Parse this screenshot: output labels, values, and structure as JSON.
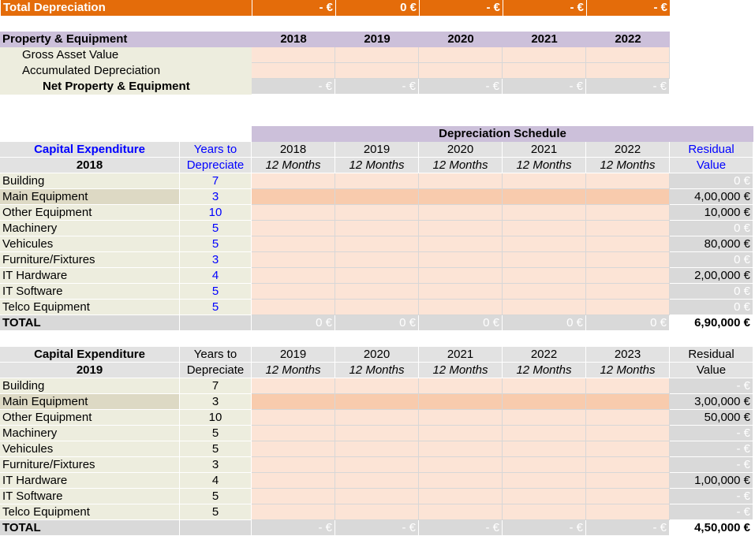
{
  "total_depreciation": {
    "label": "Total Depreciation",
    "values": [
      "- €",
      "0 €",
      "- €",
      "- €",
      "- €"
    ]
  },
  "property_equipment": {
    "title": "Property & Equipment",
    "years": [
      "2018",
      "2019",
      "2020",
      "2021",
      "2022"
    ],
    "rows": [
      {
        "label": "Gross Asset Value"
      },
      {
        "label": "Accumulated Depreciation"
      }
    ],
    "net_label": "Net Property & Equipment",
    "net_values": [
      "- €",
      "- €",
      "- €",
      "- €",
      "- €"
    ]
  },
  "schedule_title": "Depreciation Schedule",
  "block_2018": {
    "title_line1": "Capital Expenditure",
    "title_line2": "2018",
    "years_to_line1": "Years to",
    "years_to_line2": "Depreciate",
    "years": [
      "2018",
      "2019",
      "2020",
      "2021",
      "2022"
    ],
    "period": "12 Months",
    "residual_line1": "Residual",
    "residual_line2": "Value",
    "rows": [
      {
        "label": "Building",
        "years": "7",
        "residual": "0 €"
      },
      {
        "label": "Main Equipment",
        "years": "3",
        "residual": "4,00,000 €"
      },
      {
        "label": "Other Equipment",
        "years": "10",
        "residual": "10,000 €"
      },
      {
        "label": "Machinery",
        "years": "5",
        "residual": "0 €"
      },
      {
        "label": "Vehicules",
        "years": "5",
        "residual": "80,000 €"
      },
      {
        "label": "Furniture/Fixtures",
        "years": "3",
        "residual": "0 €"
      },
      {
        "label": "IT Hardware",
        "years": "4",
        "residual": "2,00,000 €"
      },
      {
        "label": "IT Software",
        "years": "5",
        "residual": "0 €"
      },
      {
        "label": "Telco Equipment",
        "years": "5",
        "residual": "0 €"
      }
    ],
    "total_label": "TOTAL",
    "total_values": [
      "0 €",
      "0 €",
      "0 €",
      "0 €",
      "0 €"
    ],
    "total_residual": "6,90,000 €"
  },
  "block_2019": {
    "title_line1": "Capital Expenditure",
    "title_line2": "2019",
    "years_to_line1": "Years to",
    "years_to_line2": "Depreciate",
    "years": [
      "2019",
      "2020",
      "2021",
      "2022",
      "2023"
    ],
    "period": "12 Months",
    "residual_line1": "Residual",
    "residual_line2": "Value",
    "rows": [
      {
        "label": "Building",
        "years": "7",
        "residual": "- €"
      },
      {
        "label": "Main Equipment",
        "years": "3",
        "residual": "3,00,000 €"
      },
      {
        "label": "Other Equipment",
        "years": "10",
        "residual": "50,000 €"
      },
      {
        "label": "Machinery",
        "years": "5",
        "residual": "- €"
      },
      {
        "label": "Vehicules",
        "years": "5",
        "residual": "- €"
      },
      {
        "label": "Furniture/Fixtures",
        "years": "3",
        "residual": "- €"
      },
      {
        "label": "IT Hardware",
        "years": "4",
        "residual": "1,00,000 €"
      },
      {
        "label": "IT Software",
        "years": "5",
        "residual": "- €"
      },
      {
        "label": "Telco Equipment",
        "years": "5",
        "residual": "- €"
      }
    ],
    "total_label": "TOTAL",
    "total_values": [
      "- €",
      "- €",
      "- €",
      "- €",
      "- €"
    ],
    "total_residual": "4,50,000 €"
  }
}
